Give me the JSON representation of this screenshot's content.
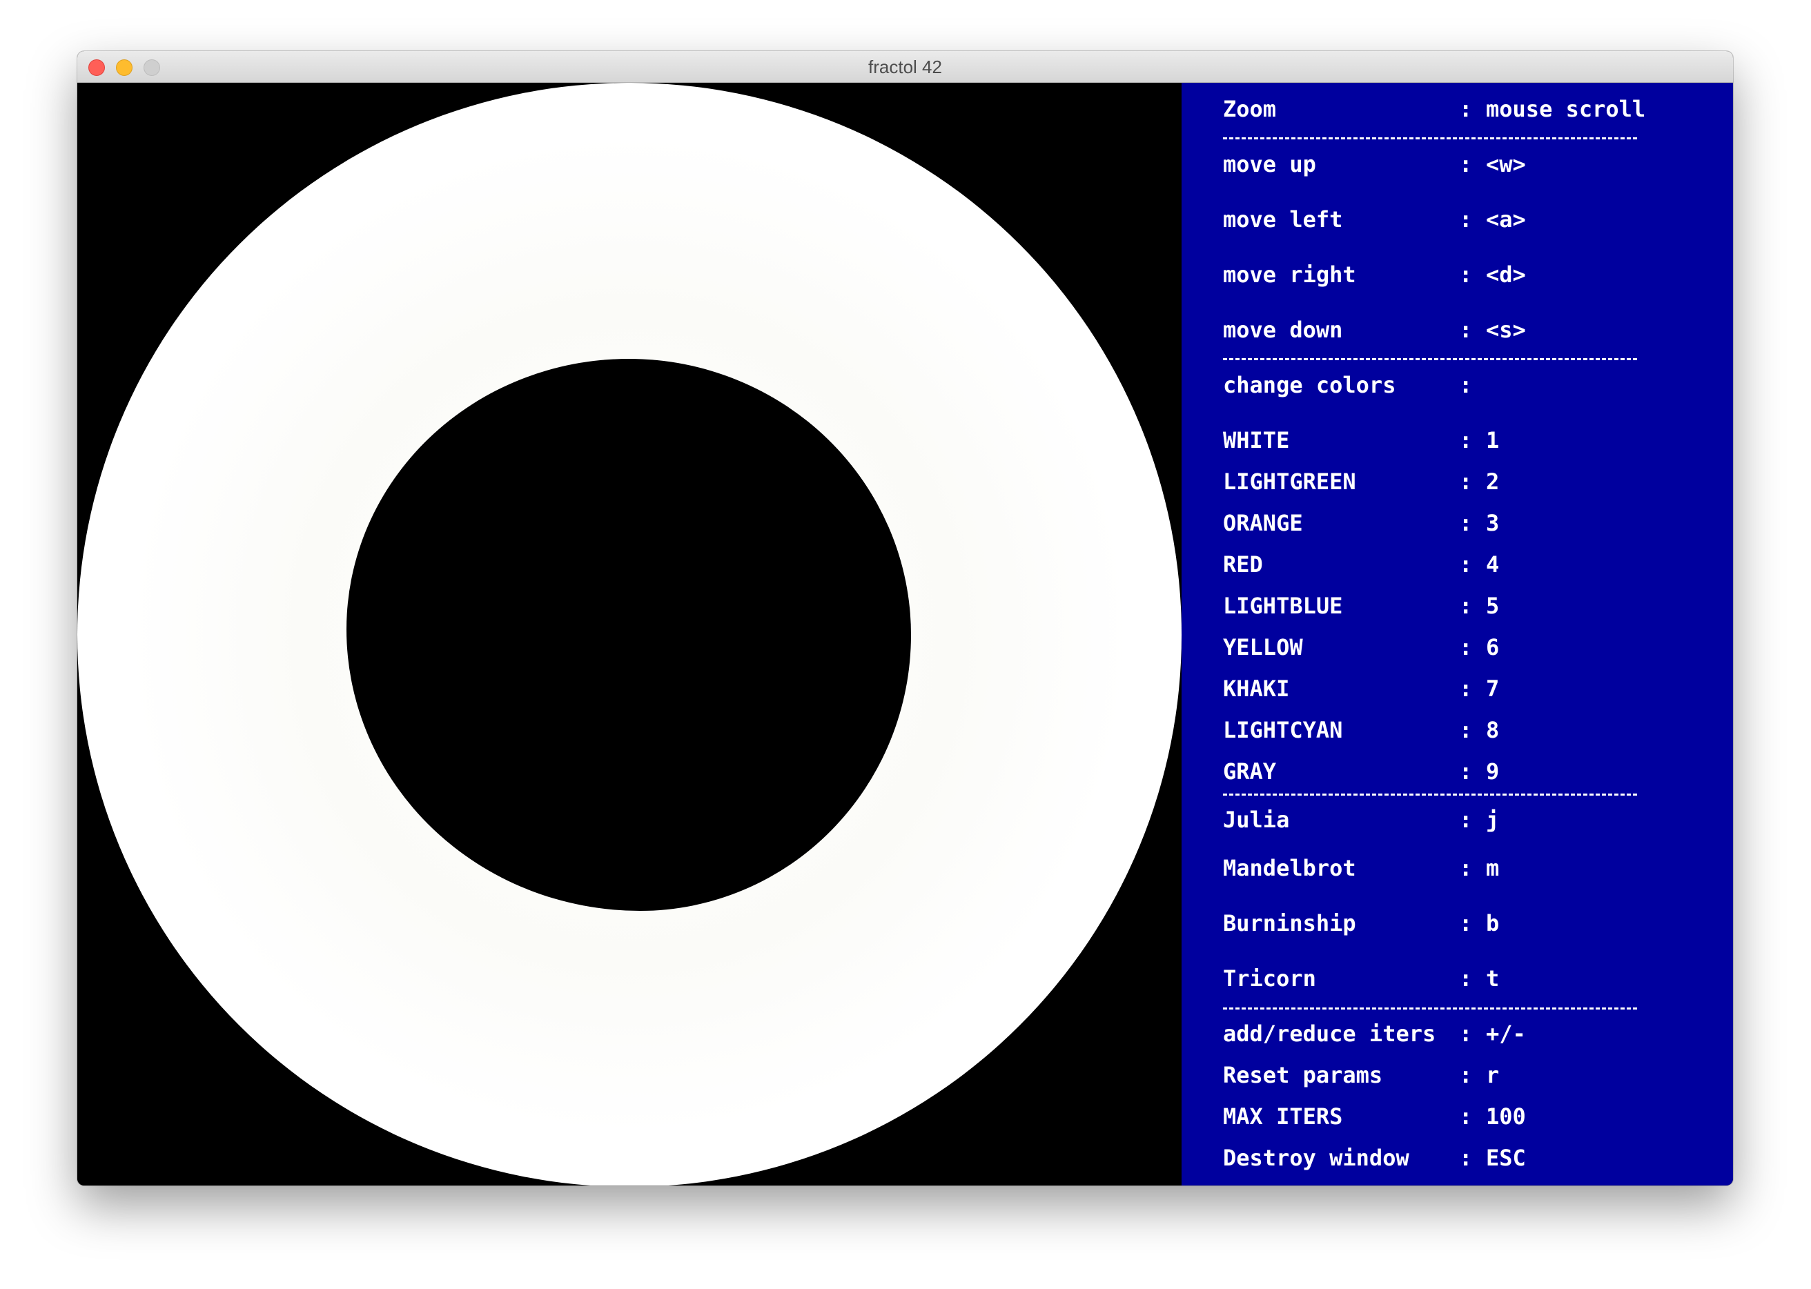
{
  "window": {
    "title": "fractol 42"
  },
  "panel": {
    "zoom": {
      "label": "Zoom",
      "value": "mouse scroll"
    },
    "move": [
      {
        "label": "move up",
        "value": "<w>"
      },
      {
        "label": "move left",
        "value": "<a>"
      },
      {
        "label": "move right",
        "value": "<d>"
      },
      {
        "label": "move down",
        "value": "<s>"
      }
    ],
    "colors_header": {
      "label": "change colors",
      "value": ""
    },
    "colors": [
      {
        "label": "WHITE",
        "value": "1"
      },
      {
        "label": "LIGHTGREEN",
        "value": "2"
      },
      {
        "label": "ORANGE",
        "value": "3"
      },
      {
        "label": "RED",
        "value": "4"
      },
      {
        "label": "LIGHTBLUE",
        "value": "5"
      },
      {
        "label": "YELLOW",
        "value": "6"
      },
      {
        "label": "KHAKI",
        "value": "7"
      },
      {
        "label": "LIGHTCYAN",
        "value": "8"
      },
      {
        "label": "GRAY",
        "value": "9"
      }
    ],
    "fractals": [
      {
        "label": "Julia",
        "value": "j"
      },
      {
        "label": "Mandelbrot",
        "value": "m"
      },
      {
        "label": "Burninship",
        "value": "b"
      },
      {
        "label": "Tricorn",
        "value": "t"
      }
    ],
    "other": [
      {
        "label": "add/reduce iters",
        "value": "+/-"
      },
      {
        "label": "Reset params",
        "value": "r"
      },
      {
        "label": "MAX ITERS",
        "value": "100"
      },
      {
        "label": "Destroy window",
        "value": "ESC"
      }
    ]
  },
  "colors": {
    "panel_bg": "#00009e",
    "canvas_bg": "#000000",
    "fractal_fill": "#ffffff",
    "text": "#ffffff"
  }
}
